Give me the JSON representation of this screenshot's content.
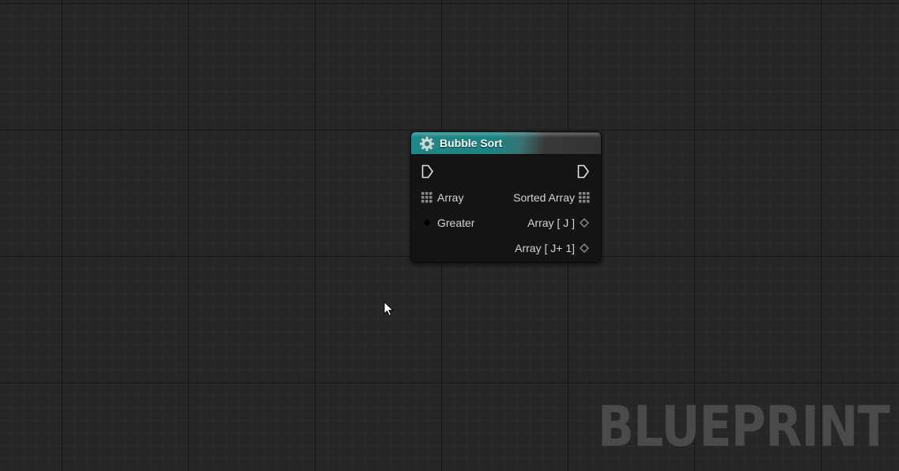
{
  "graph": {
    "watermark": "BLUEPRINT"
  },
  "node": {
    "title": "Bubble Sort",
    "title_icon": "gear-icon",
    "header_color": "#1e8a8a",
    "inputs": {
      "exec": "exec-in-pin",
      "array_label": "Array",
      "greater_label": "Greater"
    },
    "outputs": {
      "exec": "exec-out-pin",
      "sorted_array_label": "Sorted Array",
      "array_j_label": "Array [ J ]",
      "array_j1_label": "Array [ J+ 1]"
    }
  }
}
